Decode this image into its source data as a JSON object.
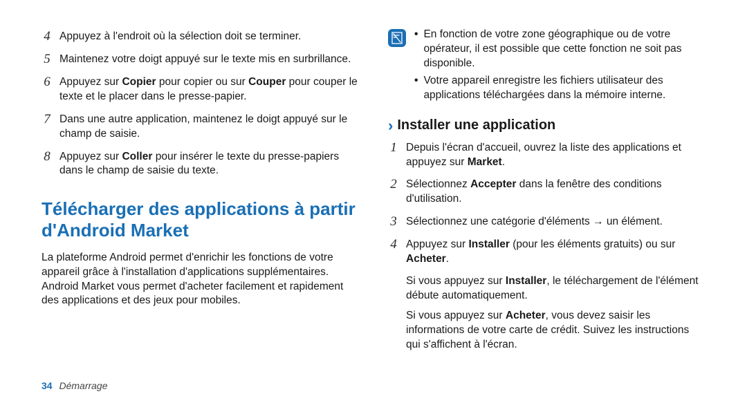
{
  "left": {
    "steps": [
      {
        "n": "4",
        "text": [
          "Appuyez à l'endroit où la sélection doit se terminer."
        ]
      },
      {
        "n": "5",
        "text": [
          "Maintenez votre doigt appuyé sur le texte mis en surbrillance."
        ]
      },
      {
        "n": "6",
        "text": [
          "Appuyez sur ",
          "Copier",
          " pour copier ou sur ",
          "Couper",
          " pour couper le texte et le placer dans le presse-papier."
        ]
      },
      {
        "n": "7",
        "text": [
          "Dans une autre application, maintenez le doigt appuyé sur le champ de saisie."
        ]
      },
      {
        "n": "8",
        "text": [
          "Appuyez sur ",
          "Coller",
          " pour insérer le texte du presse-papiers dans le champ de saisie du texte."
        ]
      }
    ],
    "heading": "Télécharger des applications à partir d'Android Market",
    "para": "La plateforme Android permet d'enrichir les fonctions de votre appareil grâce à l'installation d'applications supplémentaires. Android Market vous permet d'acheter facilement et rapidement des applications et des jeux pour mobiles."
  },
  "right": {
    "notes": [
      "En fonction de votre zone géographique ou de votre opérateur, il est possible que cette fonction ne soit pas disponible.",
      "Votre appareil enregistre les fichiers utilisateur des applications téléchargées dans la mémoire interne."
    ],
    "subheading": "Installer une application",
    "steps": [
      {
        "n": "1",
        "text": [
          "Depuis l'écran d'accueil, ouvrez la liste des applications et appuyez sur ",
          "Market",
          "."
        ]
      },
      {
        "n": "2",
        "text": [
          "Sélectionnez ",
          "Accepter",
          " dans la fenêtre des conditions d'utilisation."
        ]
      },
      {
        "n": "3",
        "text": [
          "Sélectionnez une catégorie d'éléments → un élément."
        ]
      },
      {
        "n": "4",
        "text": [
          "Appuyez sur ",
          "Installer",
          " (pour les éléments gratuits) ou sur ",
          "Acheter",
          "."
        ]
      }
    ],
    "post": [
      [
        "Si vous appuyez sur ",
        "Installer",
        ", le téléchargement de l'élément débute automatiquement."
      ],
      [
        "Si vous appuyez sur ",
        "Acheter",
        ", vous devez saisir les informations de votre carte de crédit. Suivez les instructions qui s'affichent à l'écran."
      ]
    ]
  },
  "footer": {
    "page": "34",
    "section": "Démarrage"
  }
}
